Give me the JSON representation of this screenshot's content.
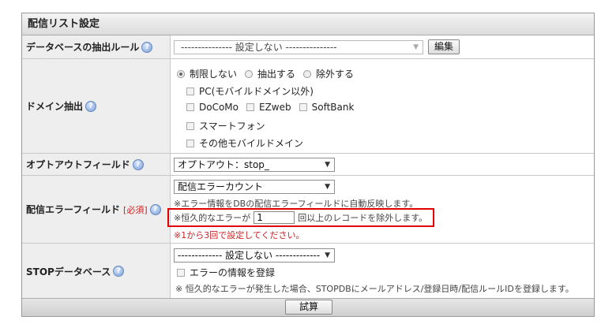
{
  "panel": {
    "title": "配信リスト設定"
  },
  "rows": {
    "db_rule": {
      "label": "データベースの抽出ルール",
      "select_value": "--------------- 設定しない ---------------",
      "edit_button": "編集"
    },
    "domain": {
      "label": "ドメイン抽出",
      "radios": [
        "制限しない",
        "抽出する",
        "除外する"
      ],
      "selected_radio": "制限しない",
      "checkboxes": {
        "pc": "PC(モバイルドメイン以外)",
        "docomo": "DoCoMo",
        "ezweb": "EZweb",
        "softbank": "SoftBank",
        "smartphone": "スマートフォン",
        "other_mobile": "その他モバイルドメイン"
      }
    },
    "optout": {
      "label": "オプトアウトフィールド",
      "select_value": "オプトアウト：stop_"
    },
    "error_field": {
      "label": "配信エラーフィールド",
      "required": "[必須]",
      "select_value": "配信エラーカウント",
      "note": "※エラー情報をDBの配信エラーフィールドに自動反映します。",
      "threshold_prefix": "※恒久的なエラーが",
      "threshold_value": "1",
      "threshold_suffix": "回以上のレコードを除外します。",
      "range_note": "※1から3回で設定してください。"
    },
    "stop_db": {
      "label": "STOPデータベース",
      "select_value": "------------- 設定しない -------------",
      "checkbox_label": "エラーの情報を登録",
      "note": "※ 恒久的なエラーが発生した場合、STOPDBにメールアドレス/登録日時/配信ルールIDを登録します。"
    }
  },
  "footer": {
    "submit_button": "試算"
  },
  "icons": {
    "help": "help-icon",
    "dropdown": "chevron-down-icon"
  },
  "colors": {
    "highlight": "#e00000",
    "required": "#cc2222"
  }
}
